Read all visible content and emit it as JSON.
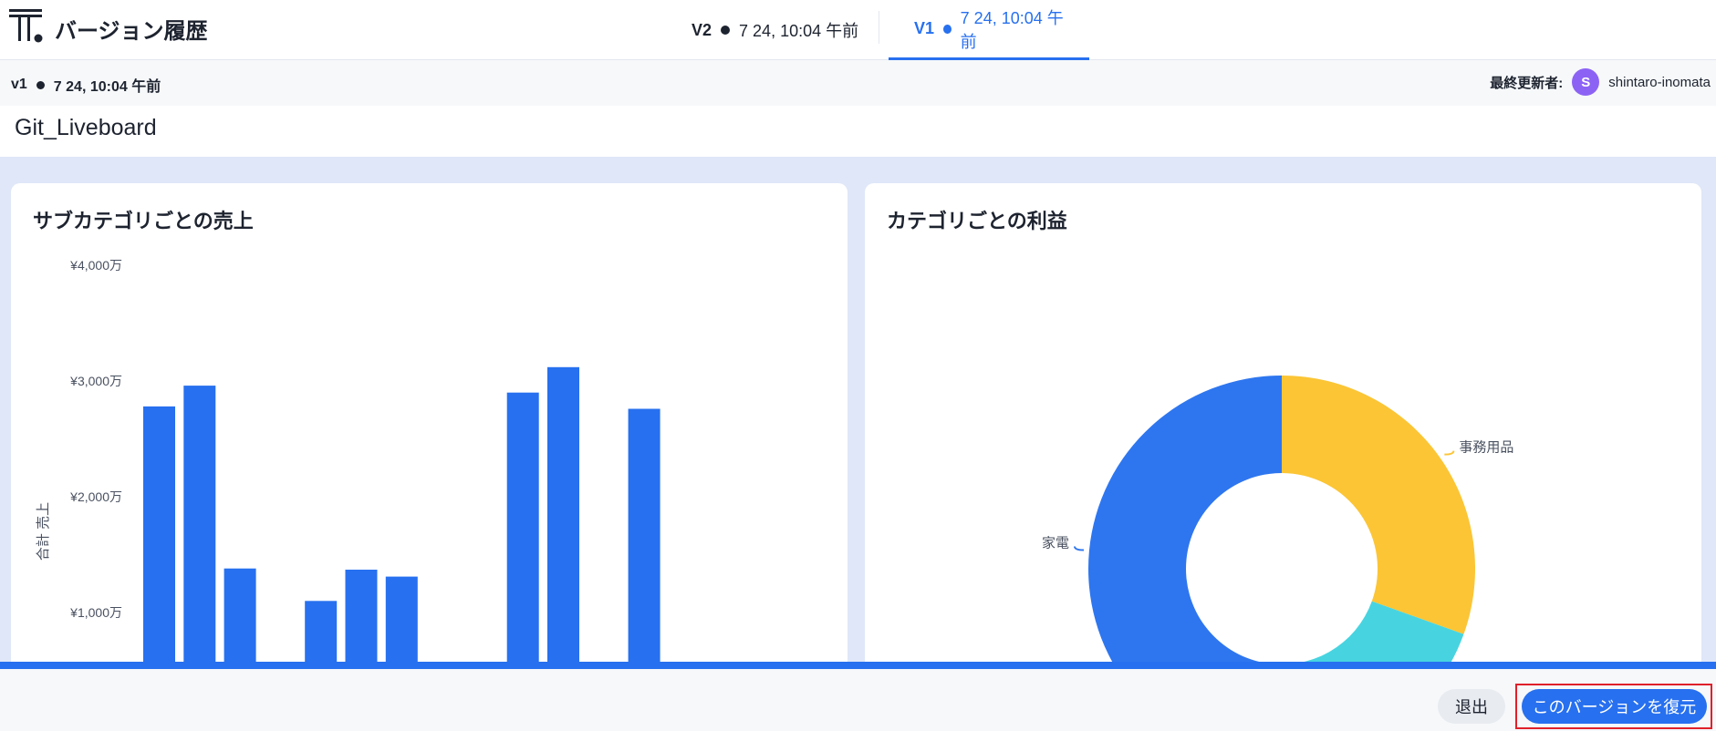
{
  "header": {
    "app_title": "バージョン履歴",
    "tabs": [
      {
        "version": "V2",
        "timestamp": "7 24, 10:04 午前",
        "active": false
      },
      {
        "version": "V1",
        "timestamp": "7 24, 10:04 午前",
        "active": true
      }
    ]
  },
  "subheader": {
    "version": "v1",
    "timestamp": "7 24, 10:04 午前",
    "updated_by_label": "最終更新者:",
    "avatar_initial": "S",
    "username": "shintaro-inomata"
  },
  "liveboard": {
    "title": "Git_Liveboard"
  },
  "charts": {
    "bar_title": "サブカテゴリごとの売上",
    "pie_title": "カテゴリごとの利益"
  },
  "chart_data": [
    {
      "type": "bar",
      "title": "サブカテゴリごとの売上",
      "ylabel": "合計 売上",
      "yticks": [
        "¥1,000万",
        "¥2,000万",
        "¥3,000万",
        "¥4,000万"
      ],
      "ylim": [
        0,
        40000000
      ],
      "values": [
        27800000,
        29600000,
        13800000,
        null,
        11000000,
        13700000,
        13100000,
        null,
        null,
        29000000,
        31200000,
        null,
        27600000
      ],
      "color": "#2770ef"
    },
    {
      "type": "pie",
      "title": "カテゴリごとの利益",
      "donut": true,
      "slices": [
        {
          "label": "事務用品",
          "value": 30.5,
          "color": "#fbc535"
        },
        {
          "label": "",
          "value": 22.5,
          "color": "#47d4e0"
        },
        {
          "label": "家電",
          "value": 47.0,
          "color": "#2e76ef"
        }
      ]
    }
  ],
  "footer": {
    "exit_label": "退出",
    "restore_label": "このバージョンを復元"
  },
  "colors": {
    "accent": "#2770ef",
    "highlight_frame": "#e0202a"
  }
}
